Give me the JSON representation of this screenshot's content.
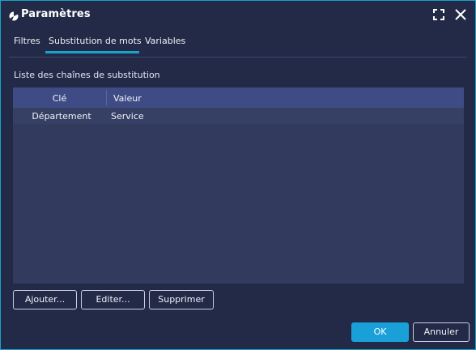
{
  "window": {
    "title": "Paramètres",
    "accent_color": "#18a3c9",
    "background_color": "#232a47"
  },
  "titlebar": {
    "app_icon": "app-logo-icon",
    "maximize_icon": "maximize-icon",
    "close_icon": "close-icon"
  },
  "tabs": [
    {
      "label": "Filtres",
      "active": false
    },
    {
      "label": "Substitution de mots",
      "active": true
    },
    {
      "label": "Variables",
      "active": false
    }
  ],
  "substitution": {
    "list_label": "Liste des chaînes de substitution",
    "columns": [
      "Clé",
      "Valeur"
    ],
    "rows": [
      {
        "key": "Département",
        "value": "Service"
      }
    ]
  },
  "buttons": {
    "add": "Ajouter...",
    "edit": "Editer...",
    "delete": "Supprimer",
    "ok": "OK",
    "cancel": "Annuler"
  }
}
